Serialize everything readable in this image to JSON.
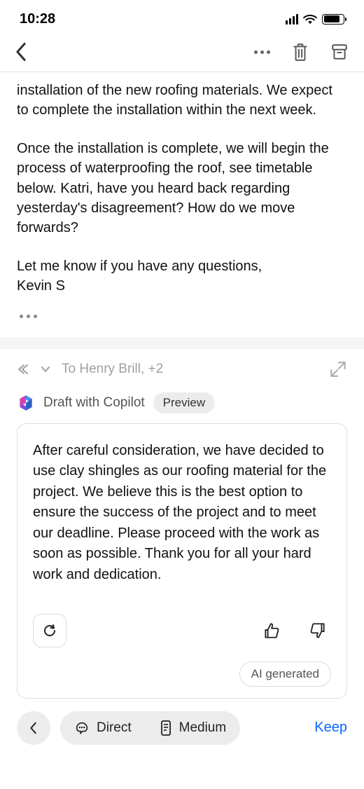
{
  "statusbar": {
    "time": "10:28"
  },
  "email": {
    "p1": "installation of the new roofing materials. We expect to complete the installation within the next week.",
    "p2": "Once the installation is complete, we will begin the process of waterproofing the roof, see timetable below. Katri, have you heard back regarding yesterday's disagreement? How do we move forwards?",
    "p3": "Let me know if you have any questions,",
    "signature": "Kevin S"
  },
  "reply": {
    "to_line": "To Henry Brill, +2"
  },
  "copilot": {
    "title": "Draft with Copilot",
    "badge": "Preview"
  },
  "draft": {
    "body": "After careful consideration, we have decided to use clay shingles as our roofing material for the project. We believe this is the best option to ensure the success of the project and to meet our deadline. Please proceed with the work as soon as possible.  Thank you for all your hard work and dedication.",
    "ai_badge": "AI generated"
  },
  "bottom": {
    "tone": "Direct",
    "length": "Medium",
    "keep": "Keep"
  }
}
